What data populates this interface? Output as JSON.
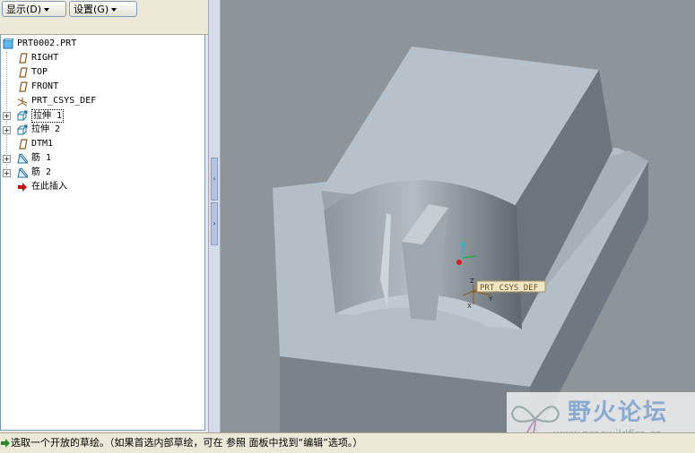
{
  "toolbar": {
    "display_label": "显示(D)",
    "settings_label": "设置(G)"
  },
  "model_tree": {
    "root": "PRT0002.PRT",
    "items": [
      {
        "label": "RIGHT",
        "icon": "datum-plane-icon",
        "expandable": false
      },
      {
        "label": "TOP",
        "icon": "datum-plane-icon",
        "expandable": false
      },
      {
        "label": "FRONT",
        "icon": "datum-plane-icon",
        "expandable": false
      },
      {
        "label": "PRT_CSYS_DEF",
        "icon": "csys-icon",
        "expandable": false
      },
      {
        "label": "拉伸 1",
        "icon": "extrude-icon",
        "expandable": true
      },
      {
        "label": "拉伸 2",
        "icon": "extrude-icon",
        "expandable": true
      },
      {
        "label": "DTM1",
        "icon": "datum-plane-icon",
        "expandable": false
      },
      {
        "label": "筋 1",
        "icon": "rib-icon",
        "expandable": true
      },
      {
        "label": "筋 2",
        "icon": "rib-icon",
        "expandable": true
      },
      {
        "label": "在此插入",
        "icon": "insert-arrow-icon",
        "expandable": false
      }
    ]
  },
  "viewport": {
    "csys_label": "PRT_CSYS_DEF",
    "axis_x": "X",
    "axis_y": "Y",
    "axis_z": "Z"
  },
  "watermark": {
    "title": "野火论坛",
    "url": "www.proewildfire.cn"
  },
  "status": {
    "message": "选取一个开放的草绘。（如果首选内部草绘，可在 参照 面板中找到“编辑”选项。）"
  },
  "colors": {
    "viewport_bg": "#8e959a",
    "model_light": "#b4bec6",
    "model_mid": "#98a3ab",
    "model_dark": "#6f7880",
    "accent_red": "#b01010"
  }
}
